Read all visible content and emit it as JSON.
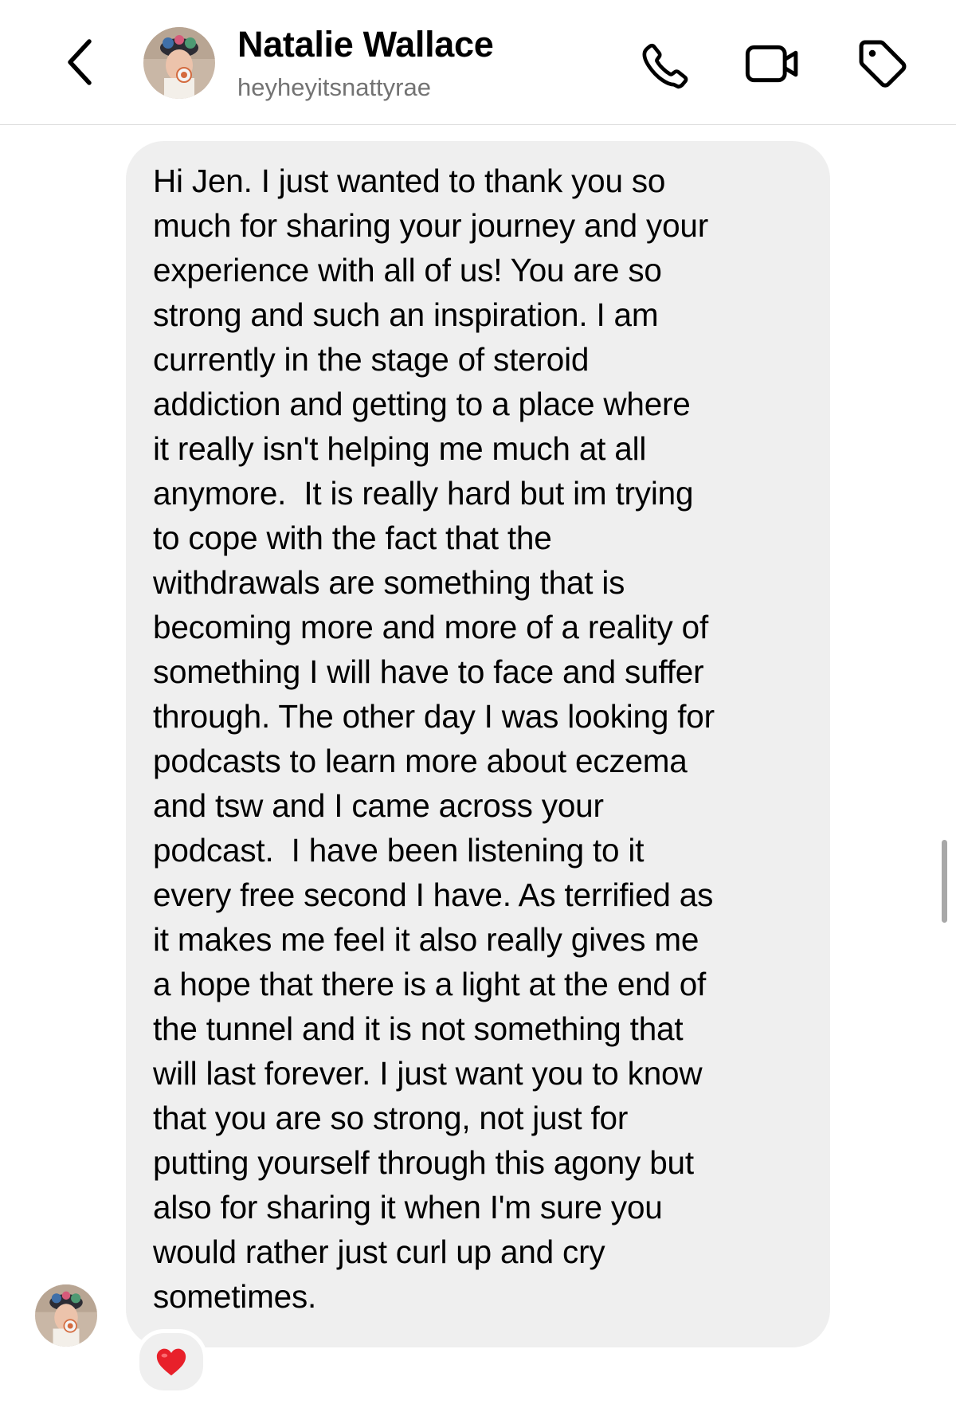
{
  "header": {
    "name": "Natalie Wallace",
    "username": "heyheyitsnattyrae",
    "back_icon": "chevron-left-icon",
    "call_icon": "phone-icon",
    "video_icon": "video-camera-icon",
    "tag_icon": "tag-icon"
  },
  "message": {
    "lines": [
      "Hi Jen. I just wanted to thank you so",
      "much for sharing your journey and your",
      "experience with all of us! You are so",
      "strong and such an inspiration. I am",
      "currently in the stage of steroid",
      "addiction and getting to a place where",
      "it really isn't helping me much at all",
      "anymore.  It is really hard but im trying",
      "to cope with the fact that the",
      "withdrawals are something that is",
      "becoming more and more of a reality of",
      "something I will have to face and suffer",
      "through. The other day I was looking for",
      "podcasts to learn more about eczema",
      "and tsw and I came across your",
      "podcast.  I have been listening to it",
      "every free second I have. As terrified as",
      "it makes me feel it also really gives me",
      "a hope that there is a light at the end of",
      "the tunnel and it is not something that",
      "will last forever. I just want you to know",
      "that you are so strong, not just for",
      "putting yourself through this agony but",
      "also for sharing it when I'm sure you",
      "would rather just curl up and cry",
      "sometimes."
    ],
    "reaction": "❤️"
  },
  "colors": {
    "bubble_background": "#efefef",
    "secondary_text": "#737373",
    "reaction_heart": "#e8202a",
    "divider": "#dbdbdb"
  }
}
